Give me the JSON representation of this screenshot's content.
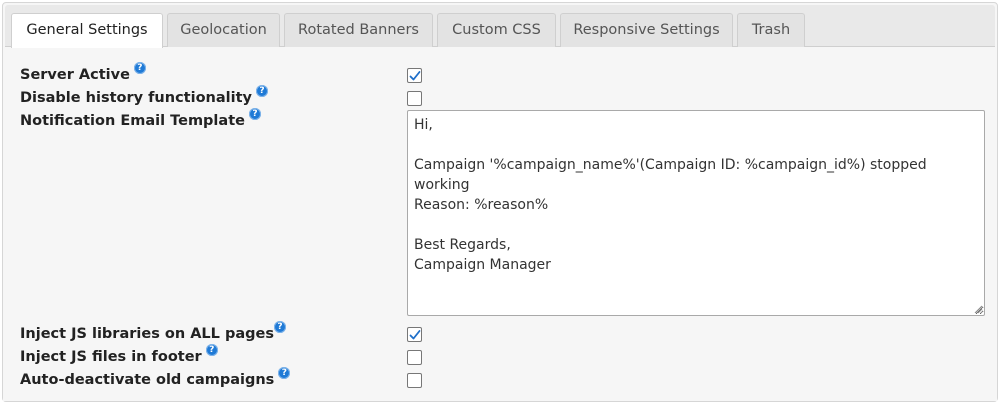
{
  "tabs": [
    {
      "label": "General Settings",
      "active": true
    },
    {
      "label": "Geolocation",
      "active": false
    },
    {
      "label": "Rotated Banners",
      "active": false
    },
    {
      "label": "Custom CSS",
      "active": false
    },
    {
      "label": "Responsive Settings",
      "active": false
    },
    {
      "label": "Trash",
      "active": false
    }
  ],
  "settings": {
    "server_active": {
      "label": "Server Active",
      "checked": true
    },
    "disable_history": {
      "label": "Disable history functionality",
      "checked": false
    },
    "notification_template": {
      "label": "Notification Email Template",
      "value": "Hi,\n\nCampaign '%campaign_name%'(Campaign ID: %campaign_id%) stopped\nworking\nReason: %reason%\n\nBest Regards,\nCampaign Manager"
    },
    "inject_js_all": {
      "label": "Inject JS libraries on ALL pages",
      "checked": true
    },
    "inject_js_footer": {
      "label": "Inject JS files in footer",
      "checked": false
    },
    "auto_deactivate": {
      "label": "Auto-deactivate old campaigns",
      "checked": false
    }
  },
  "help_glyph": "?",
  "colors": {
    "help_icon": "#1f7ad6",
    "checkmark": "#1f6fc9"
  }
}
